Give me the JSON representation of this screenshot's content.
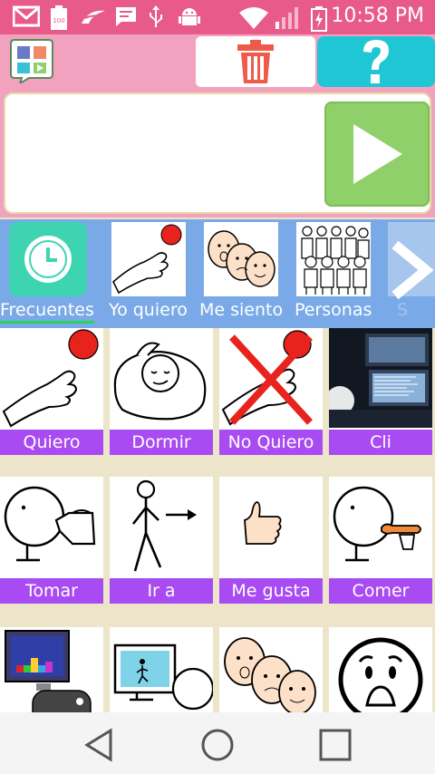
{
  "status_bar": {
    "time": "10:58 PM",
    "icons": [
      "gmail-icon",
      "battery-100-icon",
      "swiftkey-icon",
      "message-icon",
      "usb-icon",
      "android-icon",
      "wifi-icon",
      "signal-icon",
      "battery-charging-icon"
    ]
  },
  "toolbar": {
    "app_icon": "app-logo-icon",
    "trash_icon": "trash-icon",
    "help_icon": "question-icon"
  },
  "sentence": {
    "play_icon": "play-icon"
  },
  "categories": [
    {
      "label": "Frecuentes",
      "icon": "clock-icon",
      "selected": true
    },
    {
      "label": "Yo quiero",
      "icon": "hand-icon"
    },
    {
      "label": "Me siento",
      "icon": "faces-icon"
    },
    {
      "label": "Personas",
      "icon": "people-icon"
    },
    {
      "label": "S",
      "icon": "partial-icon"
    }
  ],
  "tiles": [
    {
      "label": "Quiero",
      "icon": "hand-red-ball-icon"
    },
    {
      "label": "Dormir",
      "icon": "sleep-icon"
    },
    {
      "label": "No Quiero",
      "icon": "hand-crossed-icon"
    },
    {
      "label": "Cli",
      "icon": "computer-screens-photo"
    },
    {
      "label": "Tomar",
      "icon": "drink-icon"
    },
    {
      "label": "Ir a",
      "icon": "walk-icon"
    },
    {
      "label": "Me gusta",
      "icon": "thumbs-up-icon"
    },
    {
      "label": "Comer",
      "icon": "eat-icon"
    },
    {
      "label": "",
      "icon": "videogame-icon"
    },
    {
      "label": "",
      "icon": "tv-watch-icon"
    },
    {
      "label": "",
      "icon": "faces-icon"
    },
    {
      "label": "",
      "icon": "scared-face-icon"
    }
  ],
  "navigation": {
    "back_icon": "back-triangle-icon",
    "home_icon": "home-circle-icon",
    "recents_icon": "recents-square-icon"
  }
}
